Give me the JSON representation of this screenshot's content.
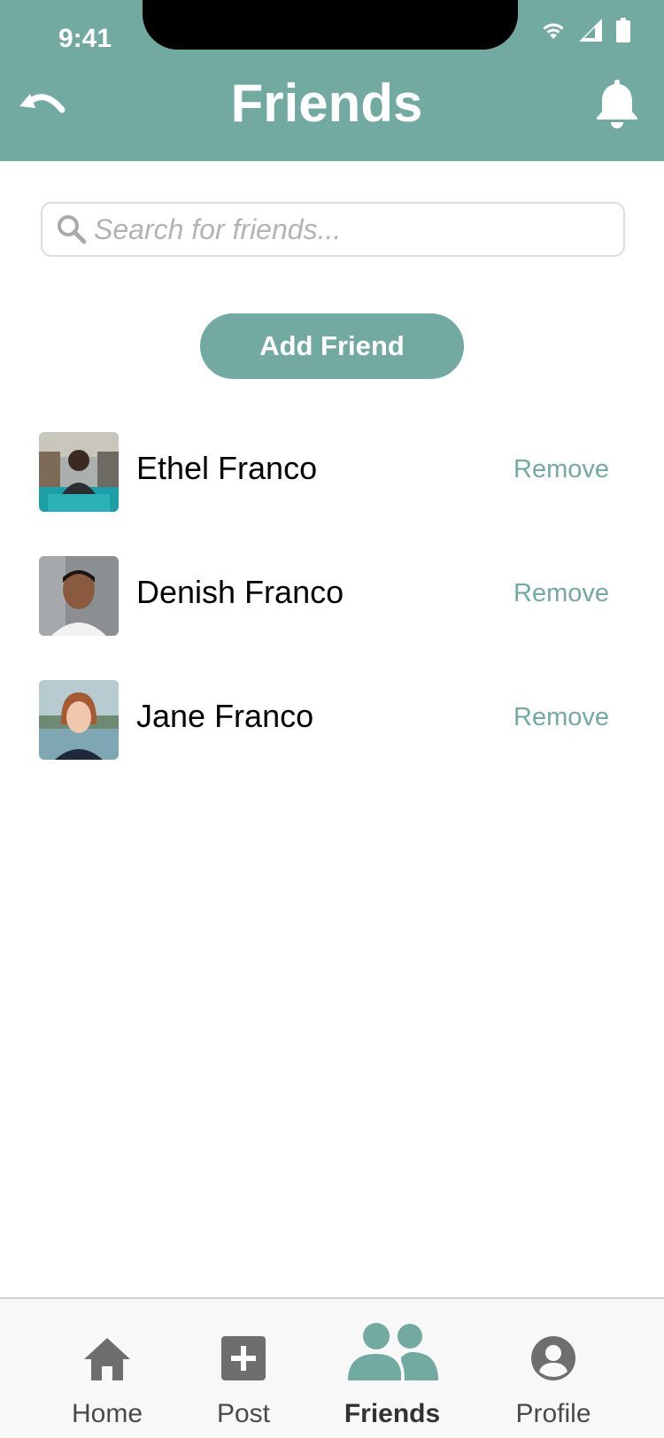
{
  "status_bar": {
    "time": "9:41"
  },
  "header": {
    "title": "Friends",
    "back_icon": "undo-arrow-icon",
    "notification_icon": "bell-icon"
  },
  "search": {
    "placeholder": "Search for friends...",
    "value": "",
    "icon": "search-icon"
  },
  "add_friend_label": "Add Friend",
  "friends": [
    {
      "name": "Ethel Franco",
      "action": "Remove"
    },
    {
      "name": "Denish Franco",
      "action": "Remove"
    },
    {
      "name": "Jane Franco",
      "action": "Remove"
    }
  ],
  "bottom_nav": {
    "items": [
      {
        "label": "Home",
        "icon": "home-icon",
        "active": false
      },
      {
        "label": "Post",
        "icon": "plus-square-icon",
        "active": false
      },
      {
        "label": "Friends",
        "icon": "people-icon",
        "active": true
      },
      {
        "label": "Profile",
        "icon": "user-circle-icon",
        "active": false
      }
    ]
  },
  "colors": {
    "accent": "#72aaa1",
    "icon_gray": "#6e6e6e",
    "nav_bg": "#f8f8f8"
  }
}
